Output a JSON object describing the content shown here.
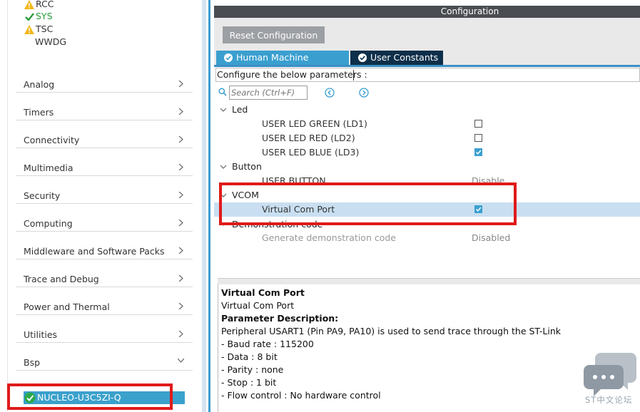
{
  "left_panel": {
    "tree_items": [
      {
        "label": "RCC",
        "status": "warning"
      },
      {
        "label": "SYS",
        "status": "ok"
      },
      {
        "label": "TSC",
        "status": "warning"
      },
      {
        "label": "WWDG",
        "status": "none"
      }
    ],
    "categories": [
      {
        "label": "Analog",
        "chevron": "right"
      },
      {
        "label": "Timers",
        "chevron": "right"
      },
      {
        "label": "Connectivity",
        "chevron": "right"
      },
      {
        "label": "Multimedia",
        "chevron": "right"
      },
      {
        "label": "Security",
        "chevron": "right"
      },
      {
        "label": "Computing",
        "chevron": "right"
      },
      {
        "label": "Middleware and Software Packs",
        "chevron": "right"
      },
      {
        "label": "Trace and Debug",
        "chevron": "right"
      },
      {
        "label": "Power and Thermal",
        "chevron": "right"
      },
      {
        "label": "Utilities",
        "chevron": "right"
      },
      {
        "label": "Bsp",
        "chevron": "down"
      }
    ],
    "selected_board": "NUCLEO-U3C5ZI-Q"
  },
  "configuration": {
    "header": "Configuration",
    "reset_button": "Reset Configuration",
    "tabs": [
      {
        "label": "Human Machine Interface",
        "active": false
      },
      {
        "label": "User Constants",
        "active": true
      }
    ],
    "configure_label": "Configure the below parameters :",
    "search_placeholder": "Search (Ctrl+F)",
    "groups": {
      "led": {
        "label": "Led",
        "params": [
          {
            "label": "USER LED GREEN (LD1)",
            "checked": false
          },
          {
            "label": "USER LED RED (LD2)",
            "checked": false
          },
          {
            "label": "USER LED BLUE (LD3)",
            "checked": true
          }
        ]
      },
      "button": {
        "label": "Button",
        "param_label": "USER BUTTON",
        "param_value": "Disable"
      },
      "vcom": {
        "label": "VCOM",
        "param_label": "Virtual Com Port",
        "checked": true
      },
      "demo": {
        "label": "Demonstration code",
        "param_label": "Generate demonstration code",
        "param_value": "Disabled"
      }
    }
  },
  "description": {
    "lines": [
      {
        "text": "Virtual Com Port",
        "bold": true
      },
      {
        "text": "Virtual Com Port",
        "bold": false
      },
      {
        "text": "Parameter Description:",
        "bold": true
      },
      {
        "text": "Peripheral USART1 (Pin PA9, PA10) is used to send trace through the ST-Link",
        "bold": false
      },
      {
        "text": "- Baud rate : 115200",
        "bold": false
      },
      {
        "text": "- Data : 8 bit",
        "bold": false
      },
      {
        "text": "- Parity : none",
        "bold": false
      },
      {
        "text": "- Stop : 1 bit",
        "bold": false
      },
      {
        "text": "- Flow control : No hardware control",
        "bold": false
      }
    ]
  },
  "watermark": {
    "text": "ST中文论坛",
    "icon": "chat-bubbles-icon"
  },
  "colors": {
    "accent": "#3a9fcf",
    "tab_active": "#0e2f4a",
    "header": "#4a4d51",
    "highlight": "#e01a1a",
    "selected_row": "#c9dff1"
  }
}
